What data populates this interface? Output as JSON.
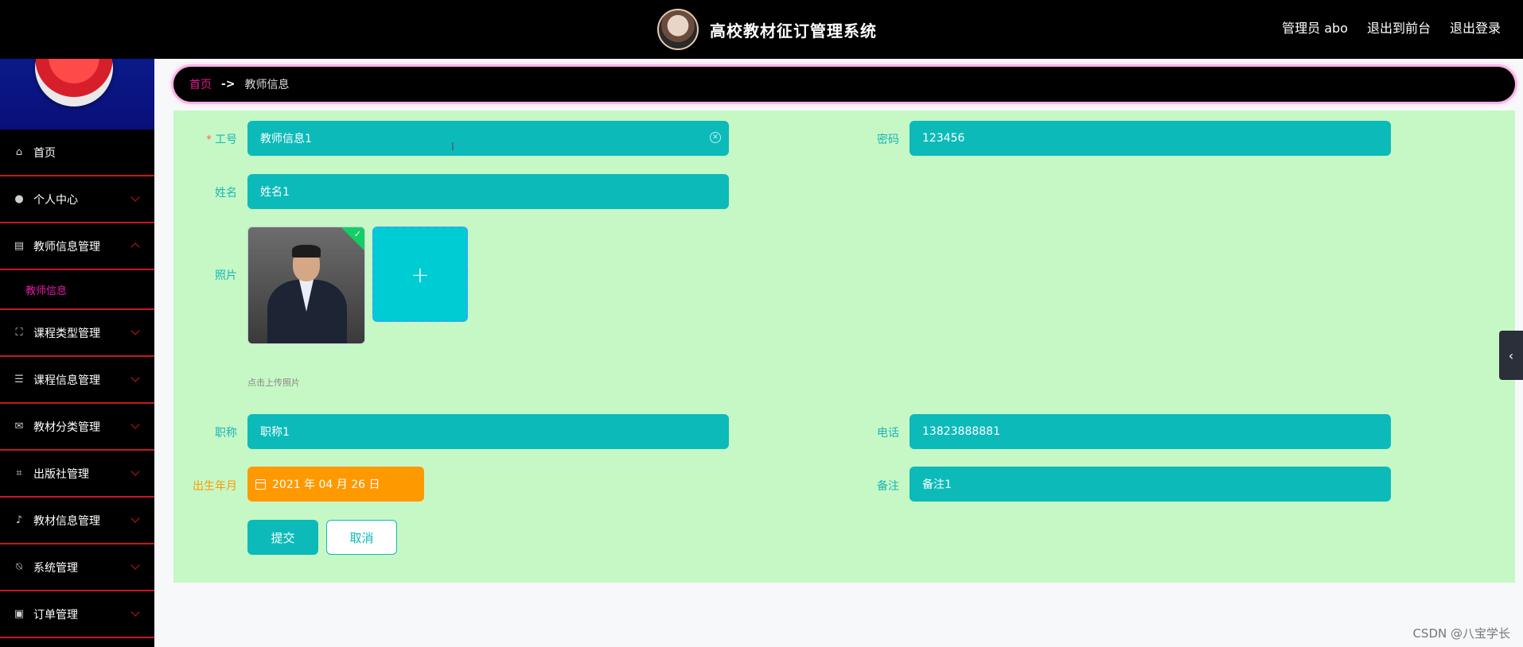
{
  "header": {
    "title": "高校教材征订管理系统",
    "links": [
      "管理员 abo",
      "退出到前台",
      "退出登录"
    ]
  },
  "sidebar": {
    "items": [
      {
        "label": "首页",
        "icon": "home-icon"
      },
      {
        "label": "个人中心",
        "icon": "user-icon"
      },
      {
        "label": "教师信息管理",
        "icon": "clipboard-icon",
        "expanded": true
      },
      {
        "label": "课程类型管理",
        "icon": "fullscreen-icon"
      },
      {
        "label": "课程信息管理",
        "icon": "sliders-icon"
      },
      {
        "label": "教材分类管理",
        "icon": "mail-icon"
      },
      {
        "label": "出版社管理",
        "icon": "crop-icon"
      },
      {
        "label": "教材信息管理",
        "icon": "microphone-icon"
      },
      {
        "label": "系统管理",
        "icon": "bell-off-icon"
      },
      {
        "label": "订单管理",
        "icon": "clipboard-check-icon"
      }
    ],
    "submenu_label": "教师信息",
    "active_color": "#e41ba6",
    "divider_color": "#c8181e"
  },
  "breadcrumb": {
    "home": "首页",
    "separator": "->",
    "current": "教师信息"
  },
  "form": {
    "gonghao_label": "工号",
    "gonghao_value": "教师信息1",
    "mima_label": "密码",
    "mima_value": "123456",
    "xingming_label": "姓名",
    "xingming_value": "姓名1",
    "zhaopian_label": "照片",
    "upload_tip": "点击上传照片",
    "zhicheng_label": "职称",
    "zhicheng_value": "职称1",
    "dianhua_label": "电话",
    "dianhua_value": "13823888881",
    "birth_label": "出生年月",
    "birth_value": "2021 年 04 月 26 日",
    "beizhu_label": "备注",
    "beizhu_value": "备注1",
    "submit_label": "提交",
    "cancel_label": "取消"
  },
  "colors": {
    "field": "#0cbaba",
    "panel": "#c6f8c6",
    "date_field": "#ff9900",
    "label": "#18b6b5"
  },
  "watermark": "CSDN @八宝学长"
}
